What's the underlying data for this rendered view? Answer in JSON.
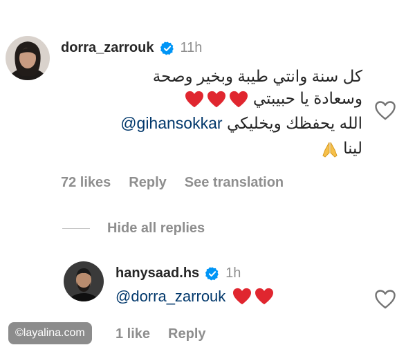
{
  "comment": {
    "username": "dorra_zarrouk",
    "time": "11h",
    "lines": [
      "كل سنة وانتي طيبة وبخير وصحة",
      "وسعادة يا حبيبتي",
      "الله يحفظك ويخليكي",
      "لينا"
    ],
    "mention": "@gihansokkar",
    "likes": "72 likes",
    "reply": "Reply",
    "see_translation": "See translation"
  },
  "replies_toggle": "Hide all replies",
  "reply": {
    "username": "hanysaad.hs",
    "time": "1h",
    "mention": "@dorra_zarrouk",
    "likes": "1 like",
    "reply": "Reply"
  },
  "watermark": "©layalina.com",
  "colors": {
    "verified": "#0095f6",
    "heart": "#e0262f",
    "mention": "#00376b",
    "muted": "#8e8e8e"
  },
  "icons": {
    "verified": "verified-badge-icon",
    "like": "heart-outline-icon",
    "pray": "folded-hands-emoji",
    "heart": "red-heart-emoji"
  }
}
